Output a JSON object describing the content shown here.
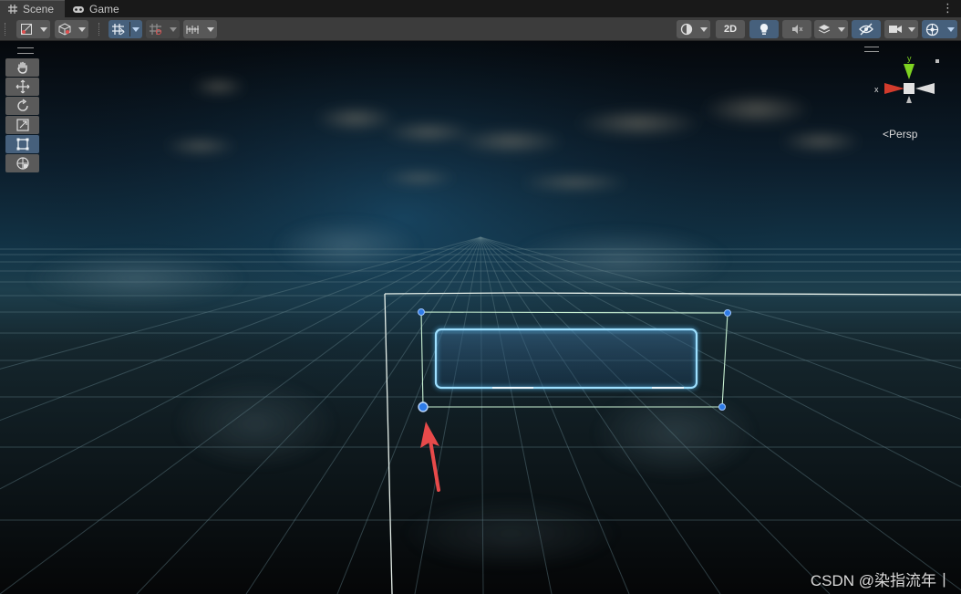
{
  "tabs": [
    {
      "label": "Scene",
      "icon": "grid-icon",
      "active": true
    },
    {
      "label": "Game",
      "icon": "gamepad-icon",
      "active": false
    }
  ],
  "toolbar": {
    "mode_2d_label": "2D",
    "tools_left": [
      "draw-mode-dropdown",
      "render-mode-cube-dropdown",
      "grid-snap-toggle",
      "increment-snap-dropdown",
      "snap-settings-dropdown"
    ],
    "tools_right": [
      "shading-dropdown",
      "2d-toggle",
      "lighting-toggle",
      "audio-toggle",
      "effects-dropdown",
      "hidden-objects-toggle",
      "scene-camera-dropdown",
      "gizmos-dropdown"
    ]
  },
  "tool_palette": [
    "hand-tool",
    "move-tool",
    "rotate-tool",
    "scale-tool",
    "rect-tool",
    "transform-tool"
  ],
  "active_tool": "rect-tool",
  "gizmo": {
    "axis_y": "y",
    "axis_x": "x",
    "projection_label": "Persp",
    "colors": {
      "x": "#d23b2c",
      "y": "#7ed321",
      "z": "#dddddd"
    }
  },
  "watermark": "CSDN @染指流年丨",
  "colors": {
    "accent": "#46607c",
    "selection_outline": "#c8f0d2",
    "handle": "#2e7be6",
    "ui_panel": "#4a9be0",
    "arrow": "#e84a4a"
  }
}
